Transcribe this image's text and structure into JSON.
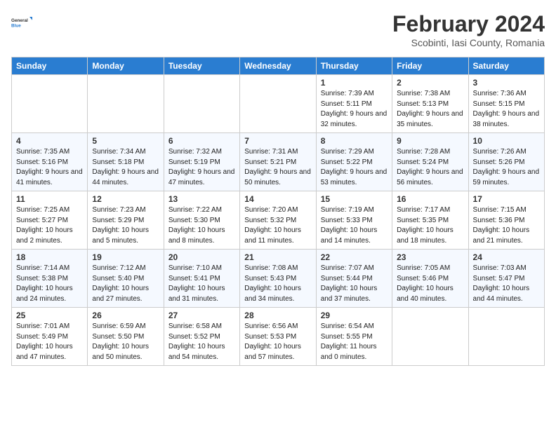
{
  "header": {
    "logo_line1": "General",
    "logo_line2": "Blue",
    "month": "February 2024",
    "location": "Scobinti, Iasi County, Romania"
  },
  "days_of_week": [
    "Sunday",
    "Monday",
    "Tuesday",
    "Wednesday",
    "Thursday",
    "Friday",
    "Saturday"
  ],
  "weeks": [
    [
      {
        "day": "",
        "info": ""
      },
      {
        "day": "",
        "info": ""
      },
      {
        "day": "",
        "info": ""
      },
      {
        "day": "",
        "info": ""
      },
      {
        "day": "1",
        "info": "Sunrise: 7:39 AM\nSunset: 5:11 PM\nDaylight: 9 hours\nand 32 minutes."
      },
      {
        "day": "2",
        "info": "Sunrise: 7:38 AM\nSunset: 5:13 PM\nDaylight: 9 hours\nand 35 minutes."
      },
      {
        "day": "3",
        "info": "Sunrise: 7:36 AM\nSunset: 5:15 PM\nDaylight: 9 hours\nand 38 minutes."
      }
    ],
    [
      {
        "day": "4",
        "info": "Sunrise: 7:35 AM\nSunset: 5:16 PM\nDaylight: 9 hours\nand 41 minutes."
      },
      {
        "day": "5",
        "info": "Sunrise: 7:34 AM\nSunset: 5:18 PM\nDaylight: 9 hours\nand 44 minutes."
      },
      {
        "day": "6",
        "info": "Sunrise: 7:32 AM\nSunset: 5:19 PM\nDaylight: 9 hours\nand 47 minutes."
      },
      {
        "day": "7",
        "info": "Sunrise: 7:31 AM\nSunset: 5:21 PM\nDaylight: 9 hours\nand 50 minutes."
      },
      {
        "day": "8",
        "info": "Sunrise: 7:29 AM\nSunset: 5:22 PM\nDaylight: 9 hours\nand 53 minutes."
      },
      {
        "day": "9",
        "info": "Sunrise: 7:28 AM\nSunset: 5:24 PM\nDaylight: 9 hours\nand 56 minutes."
      },
      {
        "day": "10",
        "info": "Sunrise: 7:26 AM\nSunset: 5:26 PM\nDaylight: 9 hours\nand 59 minutes."
      }
    ],
    [
      {
        "day": "11",
        "info": "Sunrise: 7:25 AM\nSunset: 5:27 PM\nDaylight: 10 hours\nand 2 minutes."
      },
      {
        "day": "12",
        "info": "Sunrise: 7:23 AM\nSunset: 5:29 PM\nDaylight: 10 hours\nand 5 minutes."
      },
      {
        "day": "13",
        "info": "Sunrise: 7:22 AM\nSunset: 5:30 PM\nDaylight: 10 hours\nand 8 minutes."
      },
      {
        "day": "14",
        "info": "Sunrise: 7:20 AM\nSunset: 5:32 PM\nDaylight: 10 hours\nand 11 minutes."
      },
      {
        "day": "15",
        "info": "Sunrise: 7:19 AM\nSunset: 5:33 PM\nDaylight: 10 hours\nand 14 minutes."
      },
      {
        "day": "16",
        "info": "Sunrise: 7:17 AM\nSunset: 5:35 PM\nDaylight: 10 hours\nand 18 minutes."
      },
      {
        "day": "17",
        "info": "Sunrise: 7:15 AM\nSunset: 5:36 PM\nDaylight: 10 hours\nand 21 minutes."
      }
    ],
    [
      {
        "day": "18",
        "info": "Sunrise: 7:14 AM\nSunset: 5:38 PM\nDaylight: 10 hours\nand 24 minutes."
      },
      {
        "day": "19",
        "info": "Sunrise: 7:12 AM\nSunset: 5:40 PM\nDaylight: 10 hours\nand 27 minutes."
      },
      {
        "day": "20",
        "info": "Sunrise: 7:10 AM\nSunset: 5:41 PM\nDaylight: 10 hours\nand 31 minutes."
      },
      {
        "day": "21",
        "info": "Sunrise: 7:08 AM\nSunset: 5:43 PM\nDaylight: 10 hours\nand 34 minutes."
      },
      {
        "day": "22",
        "info": "Sunrise: 7:07 AM\nSunset: 5:44 PM\nDaylight: 10 hours\nand 37 minutes."
      },
      {
        "day": "23",
        "info": "Sunrise: 7:05 AM\nSunset: 5:46 PM\nDaylight: 10 hours\nand 40 minutes."
      },
      {
        "day": "24",
        "info": "Sunrise: 7:03 AM\nSunset: 5:47 PM\nDaylight: 10 hours\nand 44 minutes."
      }
    ],
    [
      {
        "day": "25",
        "info": "Sunrise: 7:01 AM\nSunset: 5:49 PM\nDaylight: 10 hours\nand 47 minutes."
      },
      {
        "day": "26",
        "info": "Sunrise: 6:59 AM\nSunset: 5:50 PM\nDaylight: 10 hours\nand 50 minutes."
      },
      {
        "day": "27",
        "info": "Sunrise: 6:58 AM\nSunset: 5:52 PM\nDaylight: 10 hours\nand 54 minutes."
      },
      {
        "day": "28",
        "info": "Sunrise: 6:56 AM\nSunset: 5:53 PM\nDaylight: 10 hours\nand 57 minutes."
      },
      {
        "day": "29",
        "info": "Sunrise: 6:54 AM\nSunset: 5:55 PM\nDaylight: 11 hours\nand 0 minutes."
      },
      {
        "day": "",
        "info": ""
      },
      {
        "day": "",
        "info": ""
      }
    ]
  ]
}
